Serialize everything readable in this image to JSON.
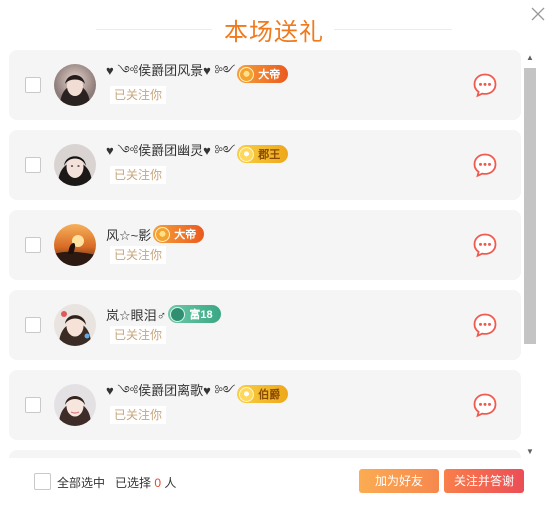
{
  "dialog": {
    "title": "本场送礼",
    "close_icon": "close-icon"
  },
  "rows": [
    {
      "name": "♥ ༺侯爵团风景♥ ༻",
      "badge": "大帝",
      "badge_style": "orange",
      "status": "已关注你"
    },
    {
      "name": "♥ ༺侯爵团幽灵♥ ༻",
      "badge": "郡王",
      "badge_style": "gold",
      "status": "已关注你"
    },
    {
      "name": "风☆~影",
      "badge": "大帝",
      "badge_style": "orange",
      "status": "已关注你"
    },
    {
      "name": "岚☆眼泪♂",
      "badge": "富18",
      "badge_style": "teal",
      "status": "已关注你"
    },
    {
      "name": "♥ ༺侯爵团离歌♥ ༻",
      "badge": "伯爵",
      "badge_style": "gold",
      "status": "已关注你"
    }
  ],
  "footer": {
    "select_all_label": "全部选中",
    "selected_prefix": "已选择",
    "selected_count": "0",
    "selected_suffix": "人",
    "add_friend_label": "加为好友",
    "follow_thank_label": "关注并答谢"
  },
  "colors": {
    "title": "#f07a1c",
    "chat_icon": "#f05a4f",
    "followed_text": "#c7a57e",
    "count": "#e64532"
  },
  "icons": [
    "close-icon",
    "chat-bubble-icon",
    "checkbox-icon",
    "crown-icon",
    "scroll-up-arrow-icon",
    "scroll-down-arrow-icon"
  ]
}
